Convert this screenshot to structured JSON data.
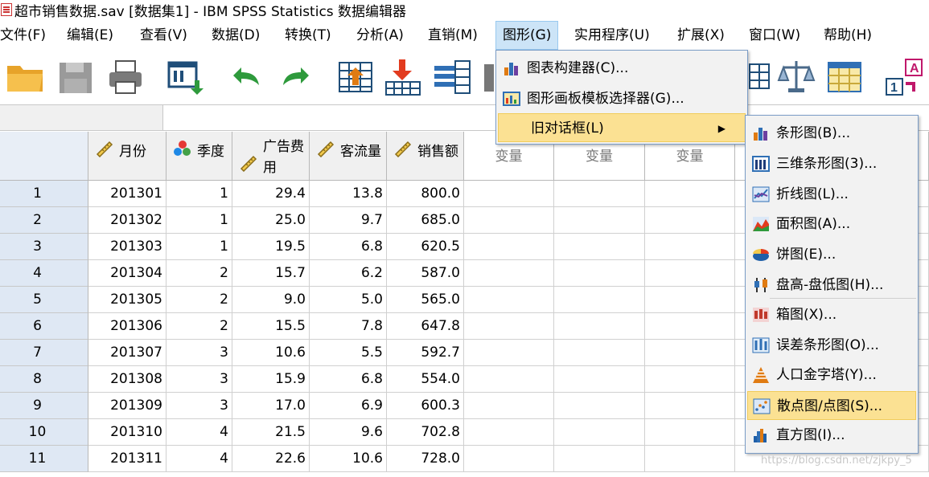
{
  "window": {
    "title": "超市销售数据.sav [数据集1] - IBM SPSS Statistics 数据编辑器"
  },
  "menubar": {
    "items": [
      "文件(F)",
      "编辑(E)",
      "查看(V)",
      "数据(D)",
      "转换(T)",
      "分析(A)",
      "直销(M)",
      "图形(G)",
      "实用程序(U)",
      "扩展(X)",
      "窗口(W)",
      "帮助(H)"
    ]
  },
  "grid": {
    "columns": [
      {
        "label": "月份",
        "type": "scale"
      },
      {
        "label": "季度",
        "type": "nominal"
      },
      {
        "label": "广告费\n用",
        "type": "scale"
      },
      {
        "label": "客流量",
        "type": "scale"
      },
      {
        "label": "销售额",
        "type": "scale"
      }
    ],
    "empty_columns": [
      "变量",
      "变量",
      "变量"
    ],
    "rows": [
      {
        "n": "1",
        "cells": [
          "201301",
          "1",
          "29.4",
          "13.8",
          "800.0"
        ]
      },
      {
        "n": "2",
        "cells": [
          "201302",
          "1",
          "25.0",
          "9.7",
          "685.0"
        ]
      },
      {
        "n": "3",
        "cells": [
          "201303",
          "1",
          "19.5",
          "6.8",
          "620.5"
        ]
      },
      {
        "n": "4",
        "cells": [
          "201304",
          "2",
          "15.7",
          "6.2",
          "587.0"
        ]
      },
      {
        "n": "5",
        "cells": [
          "201305",
          "2",
          "9.0",
          "5.0",
          "565.0"
        ]
      },
      {
        "n": "6",
        "cells": [
          "201306",
          "2",
          "15.5",
          "7.8",
          "647.8"
        ]
      },
      {
        "n": "7",
        "cells": [
          "201307",
          "3",
          "10.6",
          "5.5",
          "592.7"
        ]
      },
      {
        "n": "8",
        "cells": [
          "201308",
          "3",
          "15.9",
          "6.8",
          "554.0"
        ]
      },
      {
        "n": "9",
        "cells": [
          "201309",
          "3",
          "17.0",
          "6.9",
          "600.3"
        ]
      },
      {
        "n": "10",
        "cells": [
          "201310",
          "4",
          "21.5",
          "9.6",
          "702.8"
        ]
      },
      {
        "n": "11",
        "cells": [
          "201311",
          "4",
          "22.6",
          "10.6",
          "728.0"
        ]
      }
    ]
  },
  "graphs_menu": {
    "items": [
      {
        "label": "图表构建器(C)...",
        "icon": "chart-builder-icon"
      },
      {
        "label": "图形画板模板选择器(G)...",
        "icon": "graphboard-icon"
      },
      {
        "label": "旧对话框(L)",
        "icon": "",
        "submenu": true
      }
    ]
  },
  "legacy_menu": {
    "items": [
      {
        "label": "条形图(B)...",
        "icon": "bar-chart-icon"
      },
      {
        "label": "三维条形图(3)...",
        "icon": "3d-bar-chart-icon"
      },
      {
        "label": "折线图(L)...",
        "icon": "line-chart-icon"
      },
      {
        "label": "面积图(A)...",
        "icon": "area-chart-icon"
      },
      {
        "label": "饼图(E)...",
        "icon": "pie-chart-icon"
      },
      {
        "label": "盘高-盘低图(H)...",
        "icon": "high-low-chart-icon"
      },
      {
        "label": "箱图(X)...",
        "icon": "boxplot-icon"
      },
      {
        "label": "误差条形图(O)...",
        "icon": "error-bar-icon"
      },
      {
        "label": "人口金字塔(Y)...",
        "icon": "pyramid-icon"
      },
      {
        "label": "散点图/点图(S)...",
        "icon": "scatter-icon",
        "highlighted": true
      },
      {
        "label": "直方图(I)...",
        "icon": "histogram-icon"
      }
    ]
  },
  "watermark": "https://blog.csdn.net/zjkpy_5",
  "colors": {
    "highlight": "#fbe193",
    "menu_active": "#cce4f7",
    "row_header": "#dfe8f4"
  }
}
